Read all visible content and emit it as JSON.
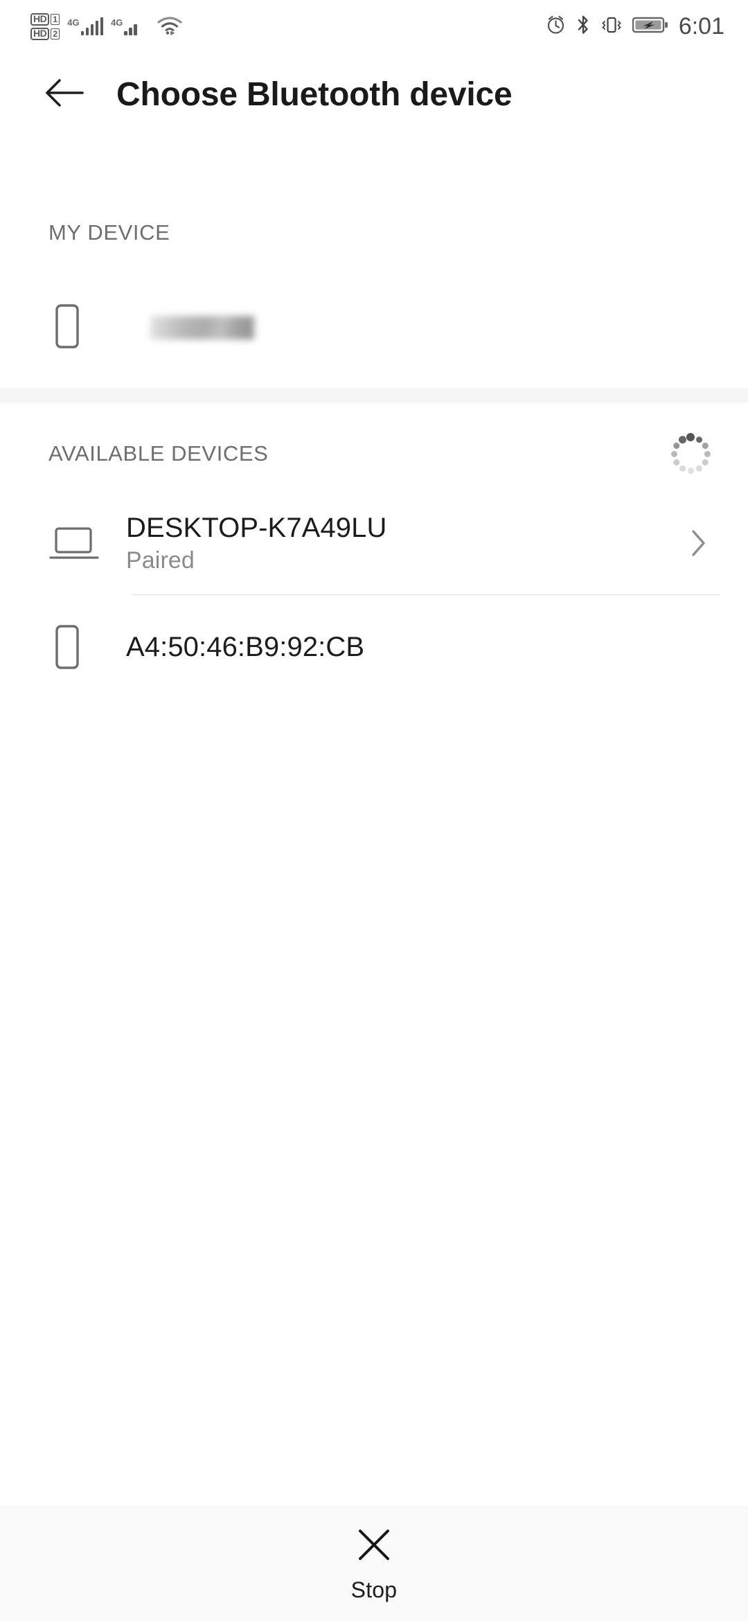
{
  "status_bar": {
    "sim1": {
      "hd_label": "HD",
      "sim_index": "1",
      "network": "4G",
      "signal_bars": 5
    },
    "sim2": {
      "hd_label": "HD",
      "sim_index": "2",
      "network": "4G",
      "signal_bars": 3
    },
    "wifi_icon": "wifi-icon",
    "alarm_icon": "alarm-clock-icon",
    "bluetooth_icon": "bluetooth-icon",
    "vibrate_icon": "vibrate-icon",
    "battery_icon": "battery-charging-icon",
    "time": "6:01"
  },
  "app_bar": {
    "back_icon": "arrow-left-icon",
    "title": "Choose Bluetooth device"
  },
  "my_device": {
    "section_label": "MY DEVICE",
    "device": {
      "icon": "phone-icon",
      "name": "",
      "redacted": true
    }
  },
  "available_devices": {
    "section_label": "AVAILABLE DEVICES",
    "scanning": true,
    "spinner_icon": "loading-spinner-icon",
    "devices": [
      {
        "icon": "laptop-icon",
        "name": "DESKTOP-K7A49LU",
        "status": "Paired",
        "has_chevron": true,
        "chevron_icon": "chevron-right-icon"
      },
      {
        "icon": "phone-icon",
        "name": "A4:50:46:B9:92:CB",
        "status": "",
        "has_chevron": false
      }
    ]
  },
  "bottom_bar": {
    "stop_icon": "close-x-icon",
    "stop_label": "Stop"
  },
  "colors": {
    "background": "#ffffff",
    "title": "#1a1a1a",
    "section_label": "#6e6e6e",
    "row_title": "#1c1c1c",
    "row_subtitle": "#8b8b8b",
    "divider": "#e2e2e2",
    "bottom_bar": "#fafafa",
    "status_icon": "#5a5a5a"
  }
}
